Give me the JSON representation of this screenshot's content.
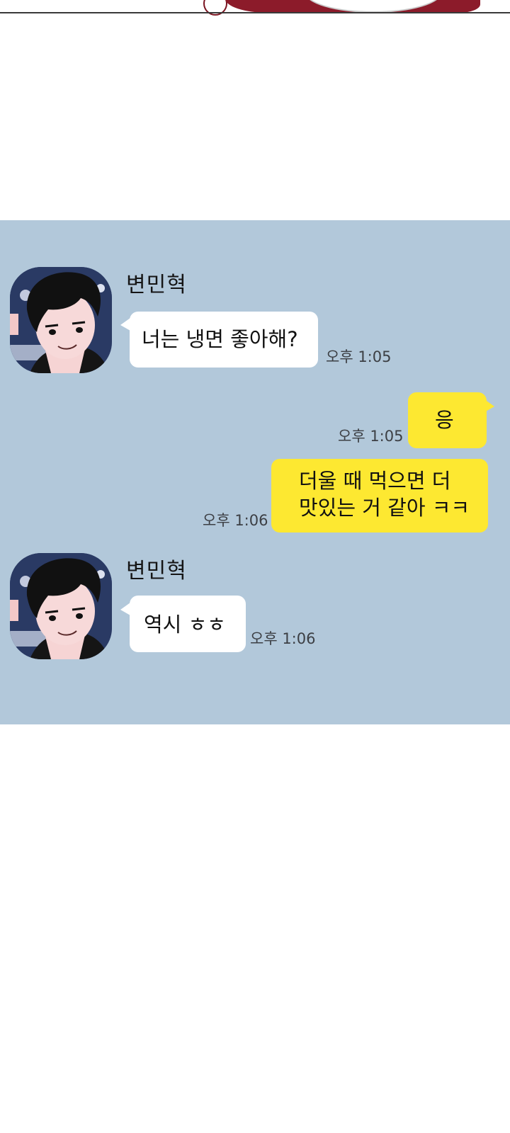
{
  "messages": [
    {
      "sender": "변민혁",
      "side": "received",
      "text": "너는 냉면 좋아해?",
      "time": "오후 1:05"
    },
    {
      "side": "sent",
      "text": "응",
      "time": "오후 1:05"
    },
    {
      "side": "sent",
      "lines": [
        "더울 때 먹으면 더",
        "맛있는 거 같아 ㅋㅋ"
      ],
      "time": "오후 1:06"
    },
    {
      "sender": "변민혁",
      "side": "received",
      "text": "역시 ㅎㅎ",
      "time": "오후 1:06"
    }
  ],
  "colors": {
    "chat_background": "#b2c8da",
    "sent_bubble": "#fde831",
    "received_bubble": "#ffffff",
    "page_background": "#ffffff"
  },
  "icons": {
    "avatar": "profile-photo-avatar"
  }
}
